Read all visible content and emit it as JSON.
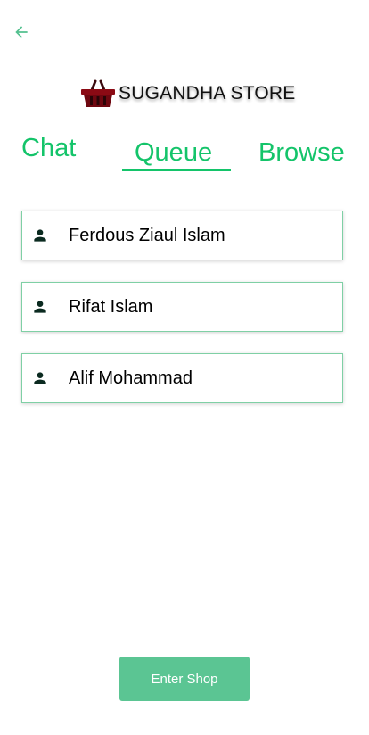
{
  "header": {
    "back_icon": "arrow-left-icon",
    "brand_icon": "shopping-basket-icon",
    "brand_name": "SUGANDHA STORE"
  },
  "tabs": [
    {
      "label": "Chat",
      "active": false
    },
    {
      "label": "Queue",
      "active": true
    },
    {
      "label": "Browse",
      "active": false
    }
  ],
  "queue": [
    {
      "name": "Ferdous Ziaul Islam",
      "icon": "person-icon"
    },
    {
      "name": "Rifat Islam",
      "icon": "person-icon"
    },
    {
      "name": "Alif Mohammad",
      "icon": "person-icon"
    }
  ],
  "footer": {
    "enter_label": "Enter Shop"
  },
  "colors": {
    "accent": "#14c46a",
    "button": "#5bc593",
    "card_border": "#7fd0a5",
    "logo": "#8b0a14"
  }
}
